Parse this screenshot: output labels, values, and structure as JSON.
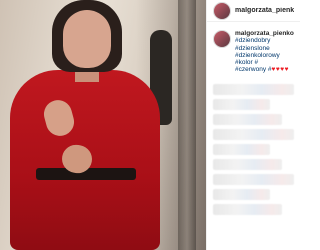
{
  "post": {
    "username": "malgorzata_pienkowsk",
    "caption": {
      "author": "malgorzata_pienkowska",
      "hashtags_line1": "#dziendobry #dzienslone",
      "hashtags_line2": "#dzienkolorowy #kolor #",
      "hashtags_line3": "#czerwony #",
      "hearts": "♥♥♥♥"
    }
  },
  "colors": {
    "coat": "#c0181f",
    "hashtag": "#00376b",
    "heart": "#ed1c24"
  },
  "icons": {
    "avatar": "avatar-icon"
  }
}
